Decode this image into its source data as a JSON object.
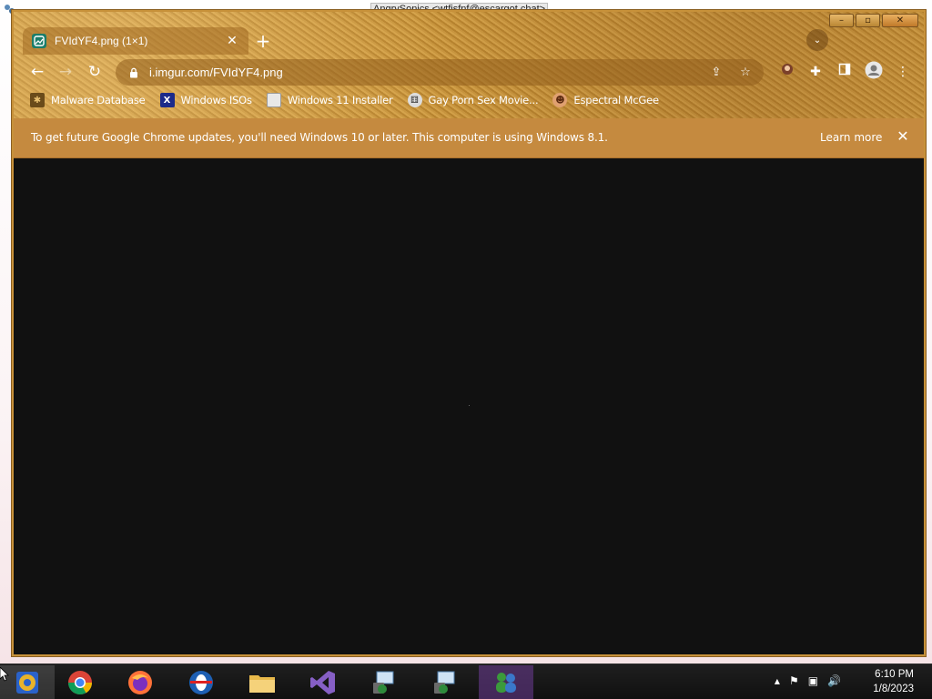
{
  "desktop": {
    "title_bar_text": "AngrySonics <wtfisfnf@escargot.chat>"
  },
  "window": {
    "minimize": "–",
    "maximize": "▫",
    "close": "✕"
  },
  "tab": {
    "title": "FVIdYF4.png (1×1)",
    "close": "✕"
  },
  "new_tab": "+",
  "tab_search": "⌄",
  "toolbar": {
    "back": "←",
    "forward": "→",
    "reload": "↻",
    "url": "i.imgur.com/FVIdYF4.png"
  },
  "bookmarks": [
    {
      "label": "Malware Database",
      "icon": "malware-favicon"
    },
    {
      "label": "Windows ISOs",
      "icon": "x-favicon"
    },
    {
      "label": "Windows 11 Installer",
      "icon": "installer-favicon"
    },
    {
      "label": "Gay Porn Sex Movie...",
      "icon": "dice-favicon"
    },
    {
      "label": "Espectral McGee",
      "icon": "character-favicon"
    }
  ],
  "infobar": {
    "message": "To get future Google Chrome updates, you'll need Windows 10 or later. This computer is using Windows 8.1.",
    "learn_more": "Learn more",
    "close": "✕"
  },
  "taskbar": {
    "apps": [
      "Chrome (active)",
      "Google Chrome",
      "Firefox",
      "Opera",
      "File Explorer",
      "Visual Studio",
      "Remote Desktop",
      "Remote Desktop",
      "Messenger"
    ],
    "time": "6:10 PM",
    "date": "1/8/2023"
  },
  "colors": {
    "frame": "#c08c38",
    "infobar": "#c58a3f",
    "content": "#111111",
    "taskbar": "#151515"
  }
}
